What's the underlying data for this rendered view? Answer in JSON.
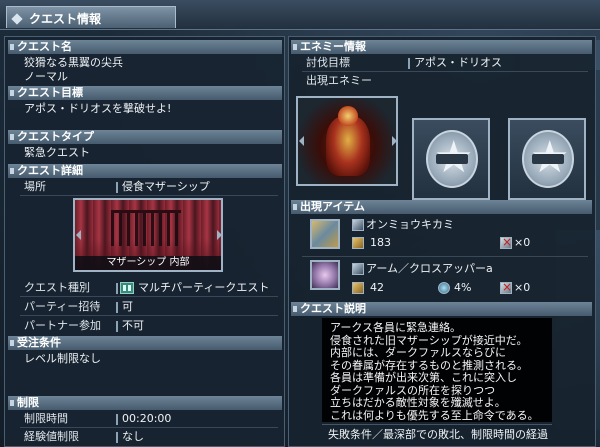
{
  "window": {
    "title": "クエスト情報"
  },
  "left": {
    "quest_name": {
      "header": "クエスト名",
      "line1": "狡猾なる黒翼の尖兵",
      "line2": "ノーマル"
    },
    "quest_goal": {
      "header": "クエスト目標",
      "text": "アポス・ドリオスを撃破せよ!"
    },
    "quest_type": {
      "header": "クエストタイプ",
      "text": "緊急クエスト"
    },
    "quest_detail": {
      "header": "クエスト詳細",
      "location_label": "場所",
      "location_value": "侵食マザーシップ",
      "thumbnail_caption": "マザーシップ 内部",
      "type_label": "クエスト種別",
      "type_value": "マルチパーティークエスト",
      "party_label": "パーティー招待",
      "party_value": "可",
      "partner_label": "パートナー参加",
      "partner_value": "不可"
    },
    "conditions": {
      "header": "受注条件",
      "text": "レベル制限なし"
    },
    "limits": {
      "header": "制限",
      "time_label": "制限時間",
      "time_value": "00:20:00",
      "exp_label": "経験値制限",
      "exp_value": "なし"
    }
  },
  "right": {
    "enemy": {
      "header": "エネミー情報",
      "target_label": "討伐目標",
      "target_value": "アポス・ドリオス",
      "appear_label": "出現エネミー"
    },
    "items": {
      "header": "出現アイテム",
      "list": [
        {
          "name": "オンミョウキカミ",
          "count_a": "183",
          "count_b": "×0"
        },
        {
          "name": "アーム／クロスアッパーa",
          "count_a": "42",
          "percent": "4%",
          "count_b": "×0"
        }
      ]
    },
    "description": {
      "header": "クエスト説明",
      "lines": [
        "アークス各員に緊急連絡。",
        "侵食された旧マザーシップが接近中だ。",
        "内部には、ダークファルスならびに",
        "その眷属が存在するものと推測される。",
        "各員は準備が出来次第、これに突入し",
        "ダークファルスの所在を探りつつ",
        "立ちはだかる敵性対象を殲滅せよ。",
        "これは何よりも優先する至上命令である。"
      ],
      "footer": "失敗条件／最深部での敗北、制限時間の経過"
    }
  },
  "colors": {
    "header_gradient_top": "#6d8396",
    "header_gradient_bottom": "#465b6e",
    "panel_bg": "#182430"
  }
}
